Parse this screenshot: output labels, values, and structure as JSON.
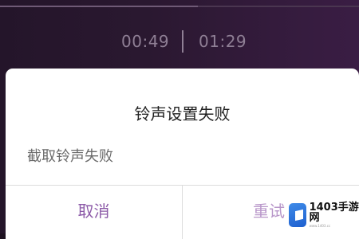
{
  "player": {
    "elapsed": "00:49",
    "duration": "01:29",
    "progress_fraction": 0.55
  },
  "dialog": {
    "title": "铃声设置失败",
    "message": "截取铃声失败",
    "cancel_label": "取消",
    "retry_label": "重试"
  },
  "watermark": {
    "text": "1403手游网",
    "subtext": "www.1403.cc"
  },
  "colors": {
    "accent": "#8c5aa8",
    "background": "#2a1830"
  }
}
